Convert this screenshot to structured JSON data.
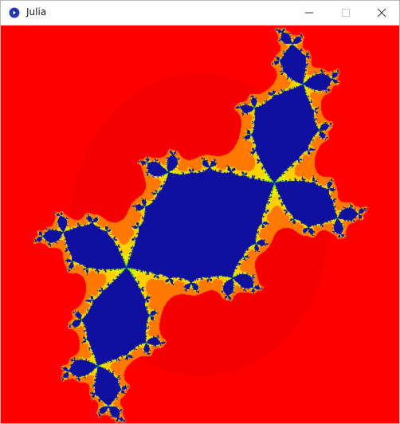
{
  "window": {
    "title": "Julia",
    "app_icon": "app-logo-icon",
    "controls": {
      "minimize": "minimize-icon",
      "maximize": "maximize-icon",
      "close": "close-icon"
    },
    "maximize_enabled": false
  },
  "fractal": {
    "type": "julia-set",
    "background_color": "#ff0000",
    "halo_color": "#f40000",
    "palette": [
      "#ff0000",
      "#ff7800",
      "#ffd000",
      "#e8f000",
      "#b4f000",
      "#6ee000",
      "#20d060",
      "#00c0c0",
      "#0050ff",
      "#1010a0"
    ]
  }
}
